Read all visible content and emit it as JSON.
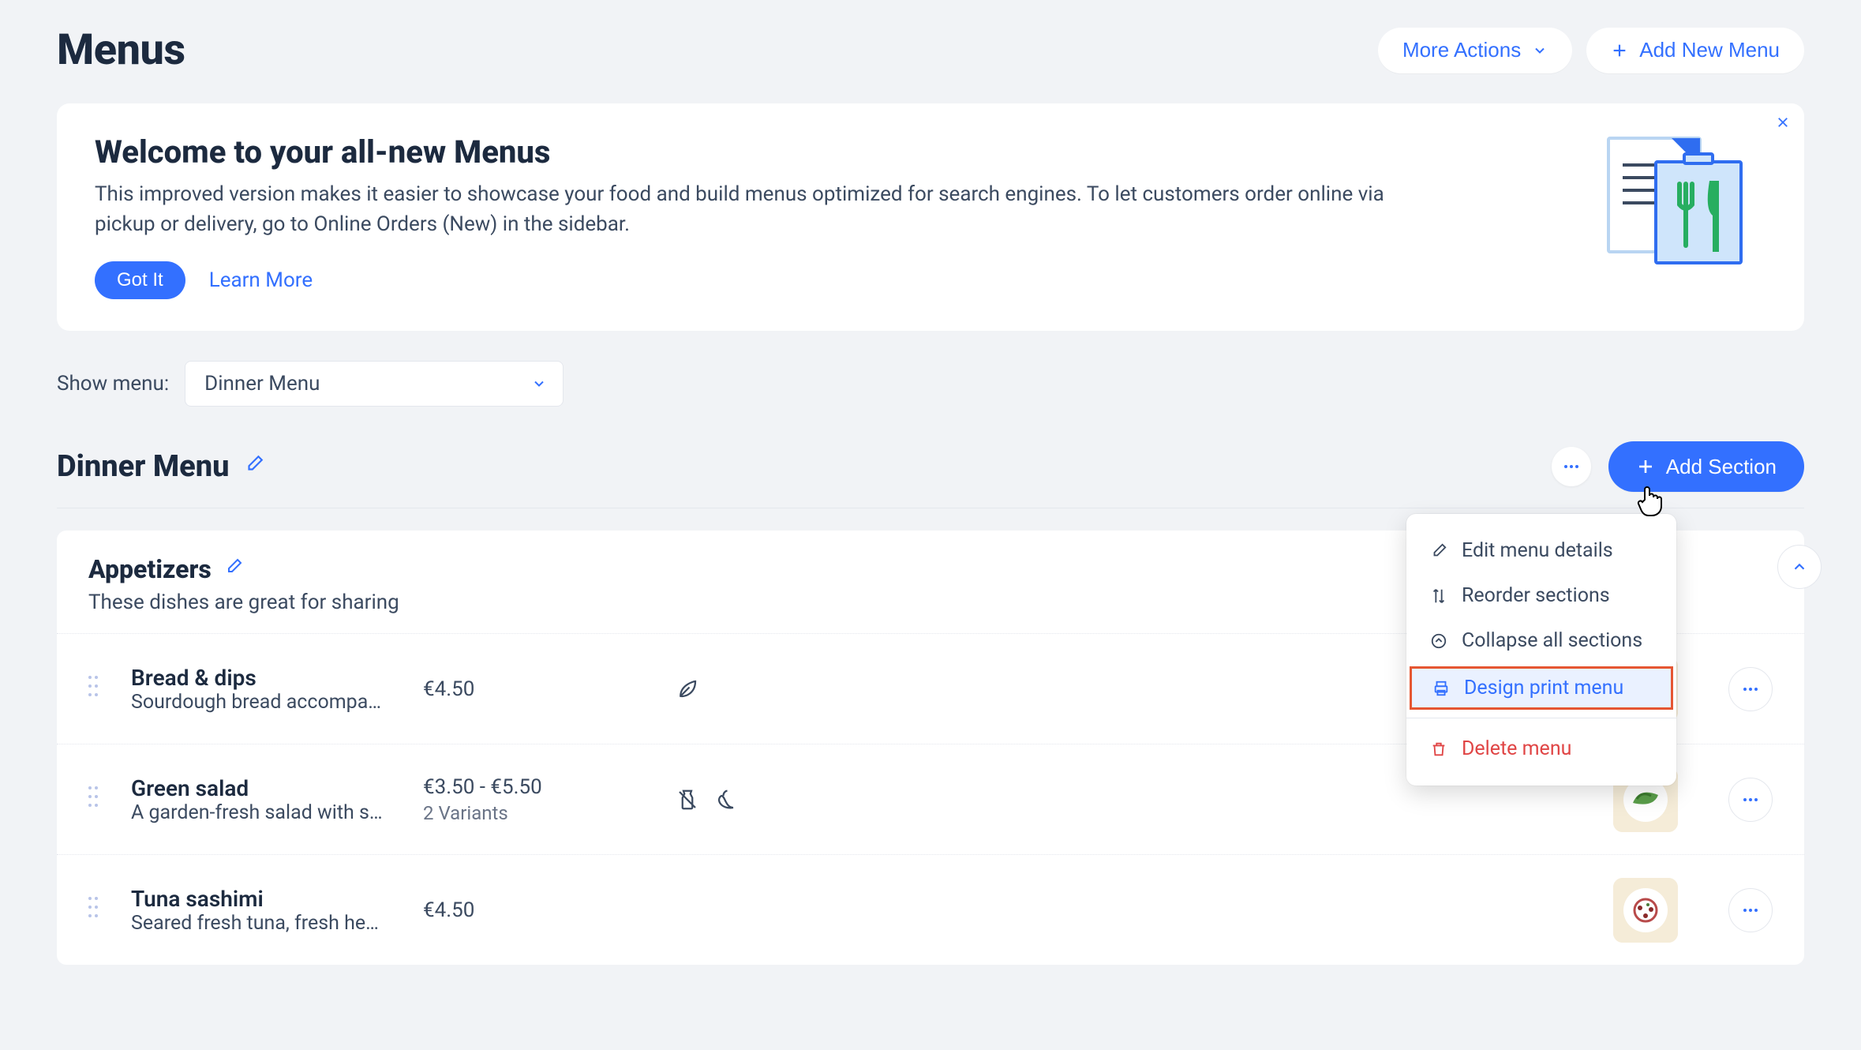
{
  "page": {
    "title": "Menus"
  },
  "header": {
    "more_actions": "More Actions",
    "add_menu": "Add New Menu"
  },
  "welcome": {
    "title": "Welcome to your all-new Menus",
    "description": "This improved version makes it easier to showcase your food and build menus optimized for search engines.  To let customers order online via pickup or delivery, go to Online Orders (New) in the sidebar.",
    "got_it": "Got It",
    "learn_more": "Learn More"
  },
  "selector": {
    "label": "Show menu:",
    "value": "Dinner Menu"
  },
  "menu": {
    "name": "Dinner Menu",
    "add_section": "Add Section"
  },
  "popover": {
    "edit_details": "Edit menu details",
    "reorder": "Reorder sections",
    "collapse": "Collapse all sections",
    "design_print": "Design print menu",
    "delete": "Delete menu"
  },
  "section": {
    "title": "Appetizers",
    "description": "These dishes are great for sharing"
  },
  "items": [
    {
      "name": "Bread & dips",
      "desc": "Sourdough bread accompa…",
      "price": "€4.50",
      "variants": "",
      "labels": [
        "leaf"
      ],
      "thumb_bg": "#f5ecd8",
      "thumb_icon": "bread"
    },
    {
      "name": "Green salad",
      "desc": "A garden-fresh salad with se…",
      "price": "€3.50 - €5.50",
      "variants": "2 Variants",
      "labels": [
        "no-dairy",
        "chili"
      ],
      "thumb_bg": "#f5ecd8",
      "thumb_icon": "salad"
    },
    {
      "name": "Tuna sashimi",
      "desc": "Seared fresh tuna, fresh her…",
      "price": "€4.50",
      "variants": "",
      "labels": [],
      "thumb_bg": "#f5ecd8",
      "thumb_icon": "tuna"
    }
  ]
}
